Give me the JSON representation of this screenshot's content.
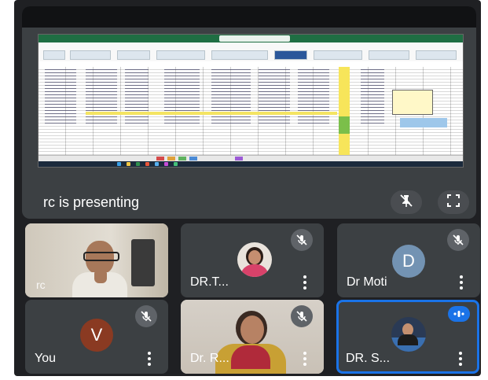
{
  "presentation": {
    "label": "rc is presenting",
    "controls": {
      "unpin_icon": "pin-off-icon",
      "fullscreen_icon": "fullscreen-icon"
    }
  },
  "shared_screen": {
    "app": "Excel"
  },
  "participants": [
    {
      "name": "",
      "video": "camera",
      "muted": false,
      "watermark": "rc"
    },
    {
      "name": "DR.T...",
      "video": "avatar-photo",
      "muted": true
    },
    {
      "name": "Dr Moti",
      "video": "letter",
      "letter": "D",
      "letter_color": "#7393b3",
      "muted": true
    },
    {
      "name": "You",
      "video": "letter",
      "letter": "V",
      "letter_color": "#8a3a22",
      "muted": true
    },
    {
      "name": "Dr. R...",
      "video": "camera",
      "muted": true
    },
    {
      "name": "DR. S...",
      "video": "avatar-photo",
      "muted": false,
      "speaking": true
    }
  ],
  "colors": {
    "background": "#1f2023",
    "tile": "#3c4043",
    "active_border": "#1a73e8"
  }
}
